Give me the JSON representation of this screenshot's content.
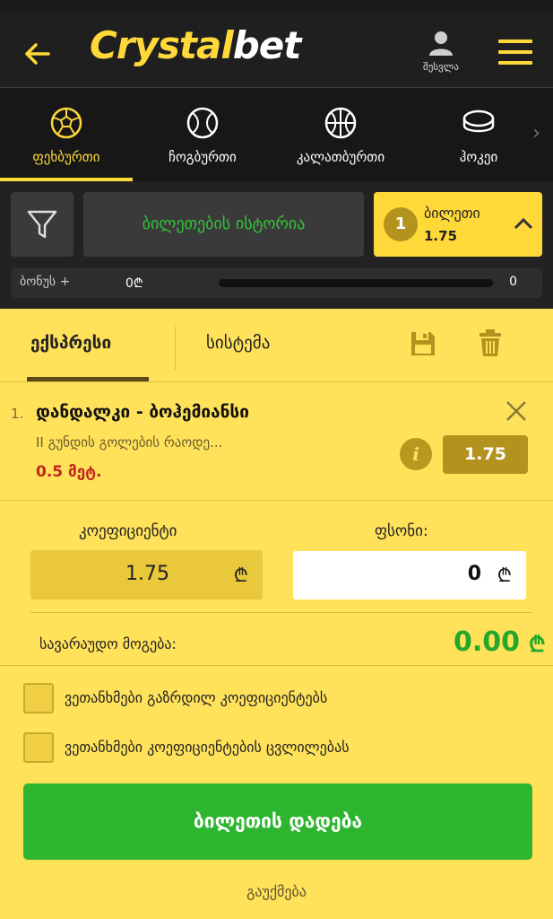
{
  "header": {
    "logo_part1": "Crystal",
    "logo_part2": "bet",
    "login_label": "შესვლა"
  },
  "sports": [
    {
      "label": "ფეხბურთი",
      "icon": "soccer-ball-icon",
      "active": true
    },
    {
      "label": "ჩოგბურთი",
      "icon": "tennis-ball-icon",
      "active": false
    },
    {
      "label": "კალათბურთი",
      "icon": "basketball-icon",
      "active": false
    },
    {
      "label": "ჰოკეი",
      "icon": "hockey-puck-icon",
      "active": false
    }
  ],
  "betslip_bar": {
    "history_label": "ბილეთების ისტორია",
    "ticket_count": "1",
    "ticket_label": "ბილეთი",
    "ticket_odds": "1.75"
  },
  "bonus": {
    "label": "ბონუს +",
    "value": "0₾",
    "end_value": "0"
  },
  "tabs": {
    "express": "ექსპრესი",
    "system": "სისტემა"
  },
  "selection": {
    "index": "1.",
    "event": "დანდალკი - ბოჰემიანსი",
    "market": "II გუნდის გოლების რაოდე...",
    "pick": "0.5 მეტ.",
    "odds": "1.75",
    "info_glyph": "i"
  },
  "stake": {
    "coef_label": "კოეფიციენტი",
    "stake_label": "ფსონი:",
    "coef_value": "1.75",
    "stake_value": "0",
    "currency": "₾",
    "win_label": "სავარაუდო მოგება:",
    "win_value": "0.00"
  },
  "options": [
    "ვეთანხმები გაზრდილ კოეფიციენტებს",
    "ვეთანხმები კოეფიციენტების ცვლილებას"
  ],
  "actions": {
    "place_bet": "ბილეთის დადება",
    "cancel": "გაუქმება"
  },
  "colors": {
    "accent": "#ffd83a",
    "panel": "#ffe15a",
    "green": "#2db52f",
    "dark": "#1f1f1f"
  }
}
